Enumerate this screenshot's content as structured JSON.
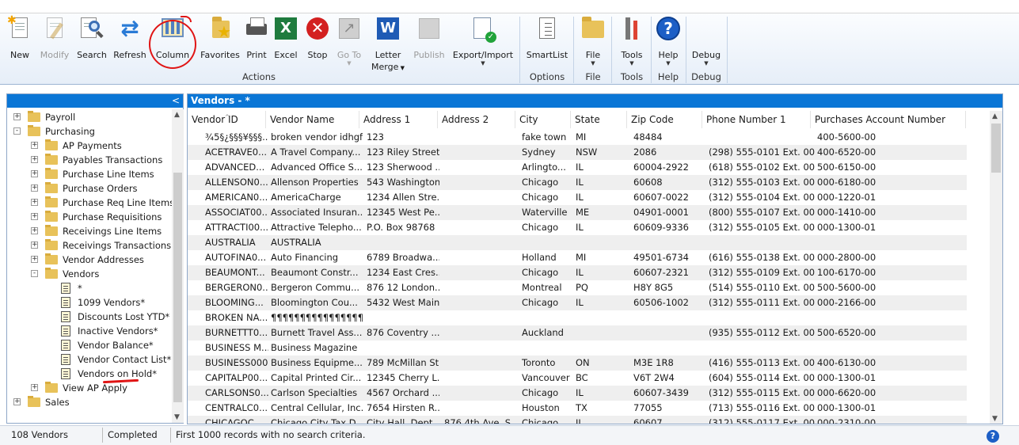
{
  "ribbon": {
    "buttons": {
      "new": "New",
      "modify": "Modify",
      "search": "Search",
      "refresh": "Refresh",
      "column": "Column",
      "favorites": "Favorites",
      "print": "Print",
      "excel": "Excel",
      "stop": "Stop",
      "goto": "Go To",
      "letter_merge_1": "Letter",
      "letter_merge_2": "Merge",
      "publish": "Publish",
      "export_import": "Export/Import",
      "smartlist": "SmartList",
      "file": "File",
      "tools": "Tools",
      "help": "Help",
      "debug": "Debug"
    },
    "groups": {
      "actions": "Actions",
      "options": "Options",
      "file": "File",
      "tools": "Tools",
      "help": "Help",
      "debug": "Debug"
    },
    "icons": {
      "x_letter": "X",
      "w_letter": "W",
      "help_symbol": "?",
      "stop_symbol": "✕"
    }
  },
  "nav": {
    "collapse_symbol": "<",
    "tree": [
      {
        "label": "Payroll",
        "type": "folder",
        "level": 1,
        "expander": "+"
      },
      {
        "label": "Purchasing",
        "type": "folder",
        "level": 1,
        "expander": "-"
      },
      {
        "label": "AP Payments",
        "type": "folder",
        "level": 2,
        "expander": "+"
      },
      {
        "label": "Payables Transactions",
        "type": "folder",
        "level": 2,
        "expander": "+"
      },
      {
        "label": "Purchase Line Items",
        "type": "folder",
        "level": 2,
        "expander": "+"
      },
      {
        "label": "Purchase Orders",
        "type": "folder",
        "level": 2,
        "expander": "+"
      },
      {
        "label": "Purchase Req Line Items",
        "type": "folder",
        "level": 2,
        "expander": "+"
      },
      {
        "label": "Purchase Requisitions",
        "type": "folder",
        "level": 2,
        "expander": "+"
      },
      {
        "label": "Receivings Line Items",
        "type": "folder",
        "level": 2,
        "expander": "+"
      },
      {
        "label": "Receivings Transactions",
        "type": "folder",
        "level": 2,
        "expander": "+"
      },
      {
        "label": "Vendor Addresses",
        "type": "folder",
        "level": 2,
        "expander": "+"
      },
      {
        "label": "Vendors",
        "type": "folder",
        "level": 2,
        "expander": "-"
      },
      {
        "label": "*",
        "type": "list",
        "level": 3,
        "expander": ""
      },
      {
        "label": "1099 Vendors*",
        "type": "list",
        "level": 3,
        "expander": ""
      },
      {
        "label": "Discounts Lost YTD*",
        "type": "list",
        "level": 3,
        "expander": ""
      },
      {
        "label": "Inactive Vendors*",
        "type": "list",
        "level": 3,
        "expander": ""
      },
      {
        "label": "Vendor Balance*",
        "type": "list",
        "level": 3,
        "expander": ""
      },
      {
        "label": "Vendor Contact List*",
        "type": "list",
        "level": 3,
        "expander": ""
      },
      {
        "label": "Vendors on Hold*",
        "type": "list",
        "level": 3,
        "expander": ""
      },
      {
        "label": "View AP Apply",
        "type": "folder",
        "level": 2,
        "expander": "+"
      },
      {
        "label": "Sales",
        "type": "folder",
        "level": 1,
        "expander": "+"
      }
    ]
  },
  "list": {
    "title": "Vendors - *",
    "columns": [
      "Vendor ID",
      "Vendor Name",
      "Address 1",
      "Address 2",
      "City",
      "State",
      "Zip Code",
      "Phone Number 1",
      "Purchases Account Number"
    ],
    "rows": [
      [
        "¾5§¿§§§¥§§§...",
        "broken vendor idhgf",
        "123",
        "",
        "fake town",
        "MI",
        "48484",
        "",
        "400-5600-00"
      ],
      [
        "ACETRAVE0...",
        "A Travel Company...",
        "123 Riley Street",
        "",
        "Sydney",
        "NSW",
        "2086",
        "(298) 555-0101  Ext. 00...",
        "400-6520-00"
      ],
      [
        "ADVANCED...",
        "Advanced Office S...",
        "123 Sherwood ...",
        "",
        "Arlingto...",
        "IL",
        "60004-2922",
        "(618) 555-0102  Ext. 00...",
        "500-6150-00"
      ],
      [
        "ALLENSON0...",
        "Allenson Properties",
        "543 Washington",
        "",
        "Chicago",
        "IL",
        "60608",
        "(312) 555-0103  Ext. 00...",
        "000-6180-00"
      ],
      [
        "AMERICAN0...",
        "AmericaCharge",
        "1234 Allen Stre...",
        "",
        "Chicago",
        "IL",
        "60607-0022",
        "(312) 555-0104  Ext. 00...",
        "000-1220-01"
      ],
      [
        "ASSOCIAT00...",
        "Associated Insuran...",
        "12345 West Pe...",
        "",
        "Waterville",
        "ME",
        "04901-0001",
        "(800) 555-0107  Ext. 00...",
        "000-1410-00"
      ],
      [
        "ATTRACTI00...",
        "Attractive Telepho...",
        "P.O. Box 98768",
        "",
        "Chicago",
        "IL",
        "60609-9336",
        "(312) 555-0105  Ext. 00...",
        "000-1300-01"
      ],
      [
        "AUSTRALIA",
        "AUSTRALIA",
        "",
        "",
        "",
        "",
        "",
        "",
        ""
      ],
      [
        "AUTOFINA0...",
        "Auto Financing",
        "6789 Broadwa...",
        "",
        "Holland",
        "MI",
        "49501-6734",
        "(616) 555-0138  Ext. 00...",
        "000-2800-00"
      ],
      [
        "BEAUMONT...",
        "Beaumont Constr...",
        "1234 East Cres...",
        "",
        "Chicago",
        "IL",
        "60607-2321",
        "(312) 555-0109  Ext. 00...",
        "100-6170-00"
      ],
      [
        "BERGERON0...",
        "Bergeron Commu...",
        "876 12 London...",
        "",
        "Montreal",
        "PQ",
        "H8Y 8G5",
        "(514) 555-0110  Ext. 00...",
        "500-5600-00"
      ],
      [
        "BLOOMING...",
        "Bloomington Cou...",
        "5432 West Main",
        "",
        "Chicago",
        "IL",
        "60506-1002",
        "(312) 555-0111  Ext. 00...",
        "000-2166-00"
      ],
      [
        "BROKEN NA...",
        "¶¶¶¶¶¶¶¶¶¶¶¶¶¶¶¶¶¶",
        "",
        "",
        "",
        "",
        "",
        "",
        ""
      ],
      [
        "BURNETTT0...",
        "Burnett Travel Ass...",
        "876 Coventry ...",
        "",
        "Auckland",
        "",
        "",
        "(935) 555-0112  Ext. 00...",
        "500-6520-00"
      ],
      [
        "BUSINESS M...",
        "Business Magazine",
        "",
        "",
        "",
        "",
        "",
        "",
        ""
      ],
      [
        "BUSINESS0001",
        "Business Equipme...",
        "789 McMillan St",
        "",
        "Toronto",
        "ON",
        "M3E 1R8",
        "(416) 555-0113  Ext. 00...",
        "400-6130-00"
      ],
      [
        "CAPITALP00...",
        "Capital Printed Cir...",
        "12345 Cherry L...",
        "",
        "Vancouver",
        "BC",
        "V6T 2W4",
        "(604) 555-0114  Ext. 00...",
        "000-1300-01"
      ],
      [
        "CARLSONS0...",
        "Carlson Specialties",
        "4567 Orchard ...",
        "",
        "Chicago",
        "IL",
        "60607-3439",
        "(312) 555-0115  Ext. 00...",
        "000-6620-00"
      ],
      [
        "CENTRALC0...",
        "Central Cellular, Inc.",
        "7654 Hirsten R...",
        "",
        "Houston",
        "TX",
        "77055",
        "(713) 555-0116  Ext. 00...",
        "000-1300-01"
      ],
      [
        "CHICAGOC...",
        "Chicago City Tax D...",
        "City Hall, Dept...",
        "876 4th Ave. S...",
        "Chicago",
        "IL",
        "60607...",
        "(312) 555-0117  Ext. 00...",
        "000-2310-00"
      ]
    ]
  },
  "status": {
    "count": "108 Vendors",
    "state": "Completed",
    "message": "First 1000 records with no search criteria.",
    "help_symbol": "?"
  }
}
